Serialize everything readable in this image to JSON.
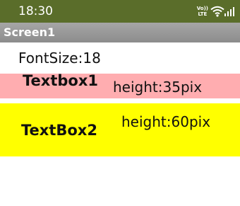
{
  "status_bar": {
    "time": "18:30",
    "volte_line1": "Vo))",
    "volte_line2": "LTE",
    "icons": [
      "volte-lte-icon",
      "wifi-icon",
      "signal-icon"
    ],
    "background": "#5a6d2a"
  },
  "title_bar": {
    "title": "Screen1"
  },
  "content": {
    "fontsize_label": "FontSize:18",
    "textbox1": {
      "text": "Textbox1",
      "height_label": "height:35pix",
      "background": "#ffadb0"
    },
    "textbox2": {
      "text": "TextBox2",
      "height_label": "height:60pix",
      "background": "#ffff00"
    }
  }
}
